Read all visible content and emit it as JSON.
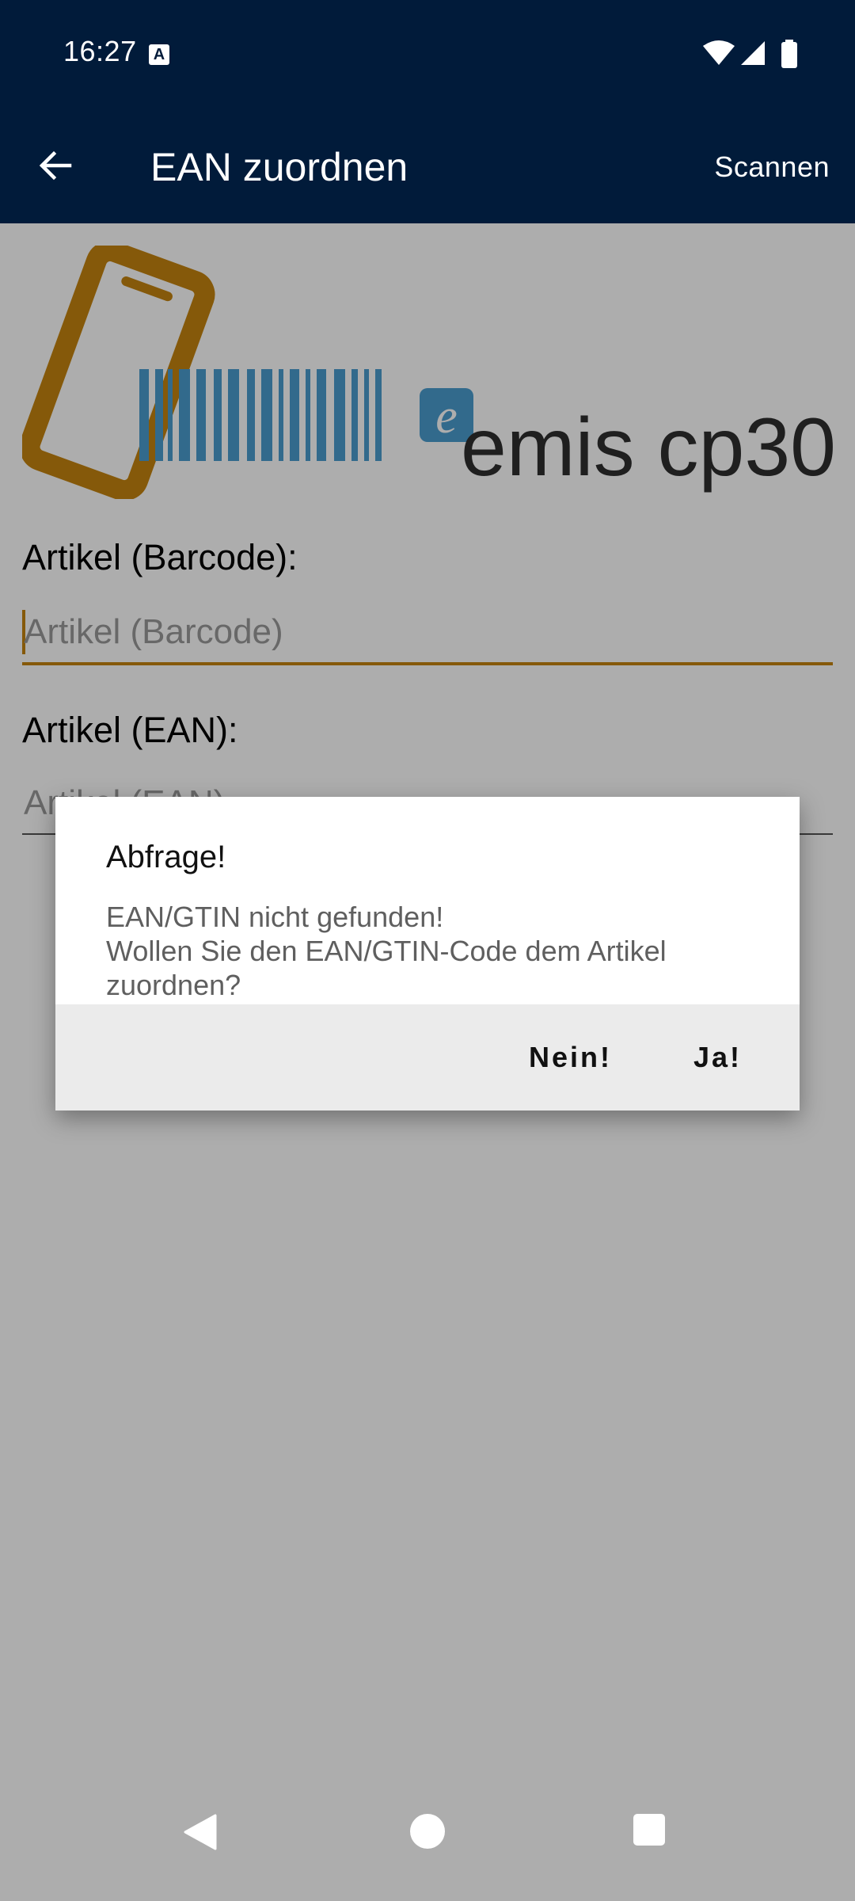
{
  "status_bar": {
    "time": "16:27",
    "notification_icon": "A",
    "icons": [
      "wifi-icon",
      "signal-icon",
      "battery-icon"
    ]
  },
  "app_bar": {
    "title": "EAN zuordnen",
    "action_label": "Scannen",
    "back_icon": "arrow-left-icon"
  },
  "logo": {
    "text": "emis cp30",
    "badge_letter": "e",
    "colors": {
      "phone": "#c5830f",
      "barcode": "#4a9ccf",
      "text": "#2e2e2e"
    }
  },
  "form": {
    "barcode": {
      "label": "Artikel (Barcode):",
      "placeholder": "Artikel (Barcode)",
      "value": ""
    },
    "ean": {
      "label": "Artikel (EAN):",
      "placeholder": "Artikel (EAN)",
      "value": ""
    }
  },
  "dialog": {
    "title": "Abfrage!",
    "message_line1": "EAN/GTIN nicht gefunden!",
    "message_line2": "Wollen Sie den EAN/GTIN-Code dem Artikel zuordnen?",
    "negative_label": "Nein!",
    "positive_label": "Ja!"
  },
  "colors": {
    "primary": "#011b3a",
    "accent": "#c5830f",
    "scrim": "rgba(0,0,0,0.32)"
  }
}
